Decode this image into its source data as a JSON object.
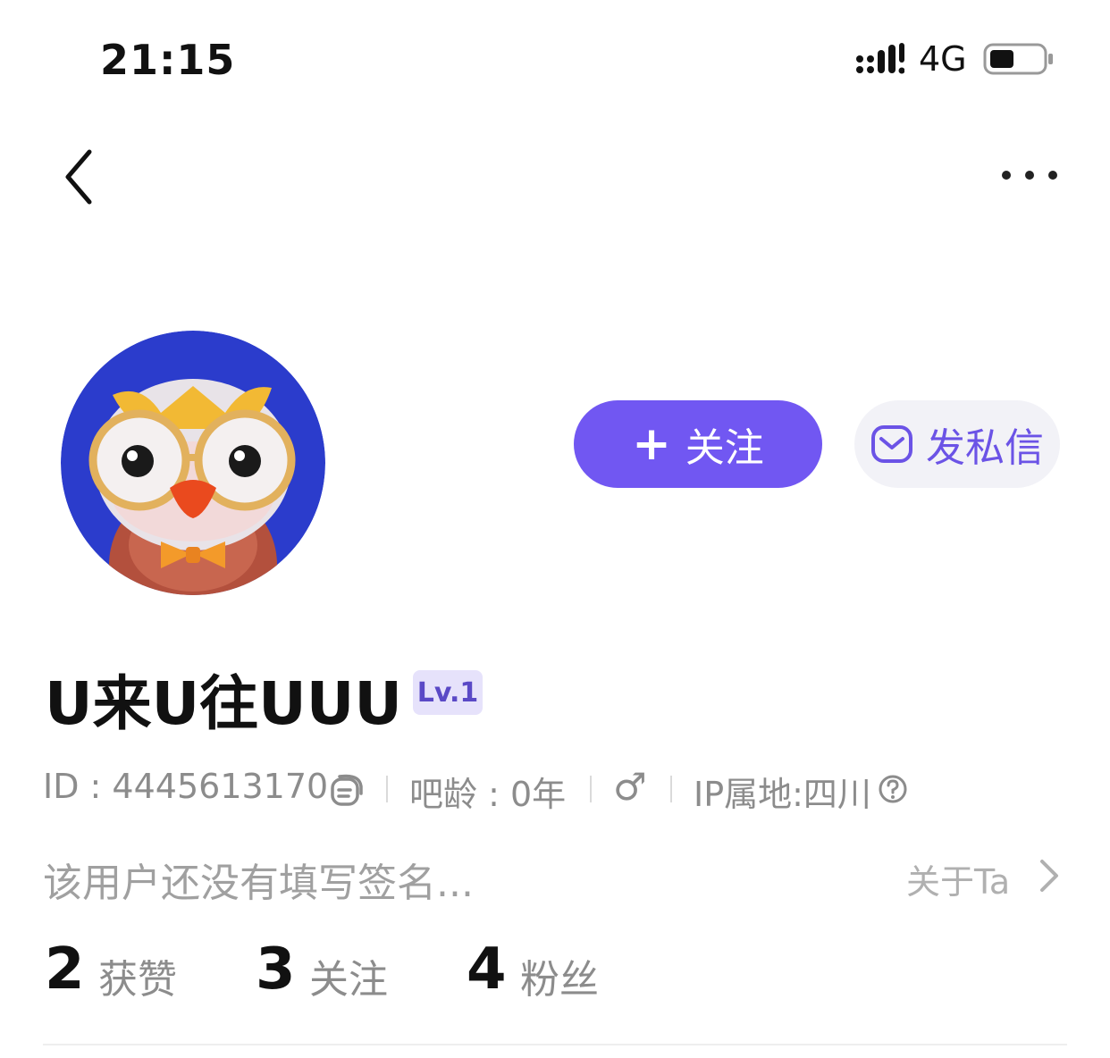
{
  "status_bar": {
    "time": "21:15",
    "network": "4G"
  },
  "profile": {
    "username": "U来U往UUU",
    "level": "Lv.1",
    "id_text": "ID : 4445613170",
    "account_age": "吧龄 : 0年",
    "gender_symbol": "♂",
    "ip_location": "IP属地:四川",
    "signature": "该用户还没有填写签名...",
    "about_label": "关于Ta"
  },
  "actions": {
    "follow_plus": "+",
    "follow_label": "关注",
    "message_label": "发私信"
  },
  "stats": [
    {
      "value": "2",
      "label": "获赞"
    },
    {
      "value": "3",
      "label": "关注"
    },
    {
      "value": "4",
      "label": "粉丝"
    }
  ],
  "colors": {
    "accent": "#7157f2",
    "message_text": "#6b53e6",
    "level_bg": "#e6e2fb",
    "avatar_bg": "#2b3ccc"
  },
  "icons": [
    "back-chevron-icon",
    "more-dots-icon",
    "copy-icon",
    "male-icon",
    "help-circle-icon",
    "mail-icon",
    "chevron-right-icon",
    "signal-icon",
    "battery-icon"
  ]
}
